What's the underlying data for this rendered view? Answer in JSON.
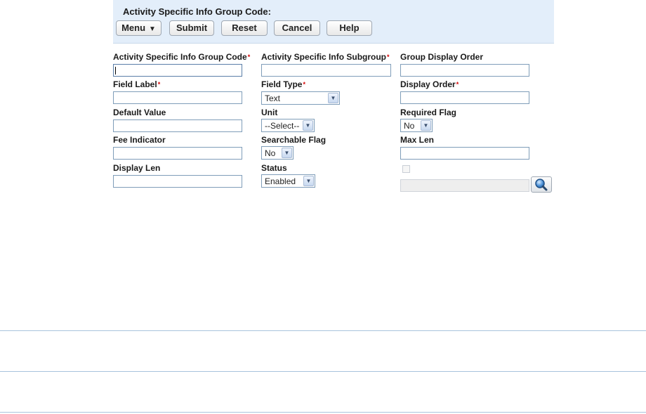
{
  "header": {
    "title": "Activity Specific Info Group Code:"
  },
  "toolbar": {
    "menu_label": "Menu",
    "submit_label": "Submit",
    "reset_label": "Reset",
    "cancel_label": "Cancel",
    "help_label": "Help"
  },
  "form": {
    "group_code_label": "Activity Specific Info Group Code",
    "subgroup_label": "Activity Specific Info Subgroup",
    "group_display_order_label": "Group Display Order",
    "field_label_label": "Field Label",
    "field_type_label": "Field Type",
    "field_type_value": "Text",
    "display_order_label": "Display Order",
    "default_value_label": "Default Value",
    "unit_label": "Unit",
    "unit_value": "--Select--",
    "required_flag_label": "Required Flag",
    "required_flag_value": "No",
    "fee_indicator_label": "Fee Indicator",
    "searchable_flag_label": "Searchable Flag",
    "searchable_flag_value": "No",
    "max_len_label": "Max Len",
    "display_len_label": "Display Len",
    "status_label": "Status",
    "status_value": "Enabled",
    "required_marker": "*"
  },
  "icons": {
    "menu_arrow": "double-down-arrow-icon",
    "select_arrow": "chevron-down-icon",
    "lookup": "magnifier-icon"
  },
  "colors": {
    "header_bg": "#e3eefa",
    "required": "#d40000",
    "divider": "#a8c3dc"
  }
}
